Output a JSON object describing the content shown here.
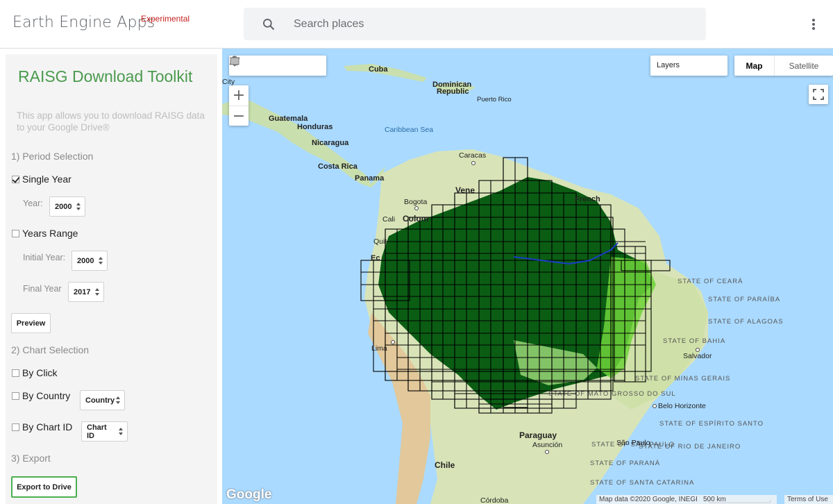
{
  "header": {
    "brand": "Earth Engine Apps",
    "badge": "Experimental",
    "search_placeholder": "Search places"
  },
  "panel": {
    "title": "RAISG Download Toolkit",
    "description": "This app allows you to download RAISG data to your Google Drive®",
    "section1": "1) Period Selection",
    "single_year_label": "Single Year",
    "single_year_checked": true,
    "year_label": "Year:",
    "year_value": "2000",
    "years_range_label": "Years Range",
    "years_range_checked": false,
    "initial_year_label": "Initial Year:",
    "initial_year_value": "2000",
    "final_year_label": "Final Year",
    "final_year_value": "2017",
    "preview_label": "Preview",
    "section2": "2) Chart Selection",
    "by_click_label": "By Click",
    "by_country_label": "By Country",
    "country_value": "Country",
    "by_chart_id_label": "By Chart ID",
    "chart_id_value": "Chart ID",
    "section3": "3) Export",
    "export_label": "Export to Drive"
  },
  "map": {
    "layers_label": "Layers",
    "map_type_map": "Map",
    "map_type_satellite": "Satellite",
    "active_map_type": "Map",
    "zoom_in": "+",
    "zoom_out": "−",
    "google_logo": "Google",
    "attribution": "Map data ©2020 Google, INEGI",
    "scale": "500 km",
    "terms": "Terms of Use",
    "labels": {
      "cuba": "Cuba",
      "city": "City",
      "dominican": "Dominican",
      "republic": "Republic",
      "puerto_rico": "Puerto Rico",
      "guatemala": "Guatemala",
      "honduras": "Honduras",
      "caribbean": "Caribbean Sea",
      "nicaragua": "Nicaragua",
      "costa_rica": "Costa Rica",
      "panama": "Panama",
      "caracas": "Caracas",
      "bogota": "Bogota",
      "cali": "Cali",
      "colombia": "Colom",
      "vene": "Vene",
      "french": "French",
      "quito": "Quit",
      "ecuador": "Ec",
      "lima": "Lima",
      "state_ceara": "STATE OF CEARÁ",
      "state_paraiba": "STATE OF PARAÍBA",
      "state_alagoas": "STATE OF ALAGOAS",
      "state_bahia": "STATE OF BAHIA",
      "salvador": "Salvador",
      "state_minas": "STATE OF MINAS GERAIS",
      "belo_horizonte": "Belo Horizonte",
      "state_espirito": "STATE OF ESPÍRITO SANTO",
      "state_rio": "STATE OF RIO DE JANEIRO",
      "state_sao_paulo": "STATE OF SÃO PAULO",
      "sao_paulo": "São Paulo",
      "state_mato": "STATE OF MATO GROSSO DO SUL",
      "state_parana": "STATE OF PARANÁ",
      "state_santa": "STATE OF SANTA CATARINA",
      "paraguay": "Paraguay",
      "asuncion": "Asunción",
      "chile": "Chile",
      "cordoba": "Córdoba"
    }
  }
}
